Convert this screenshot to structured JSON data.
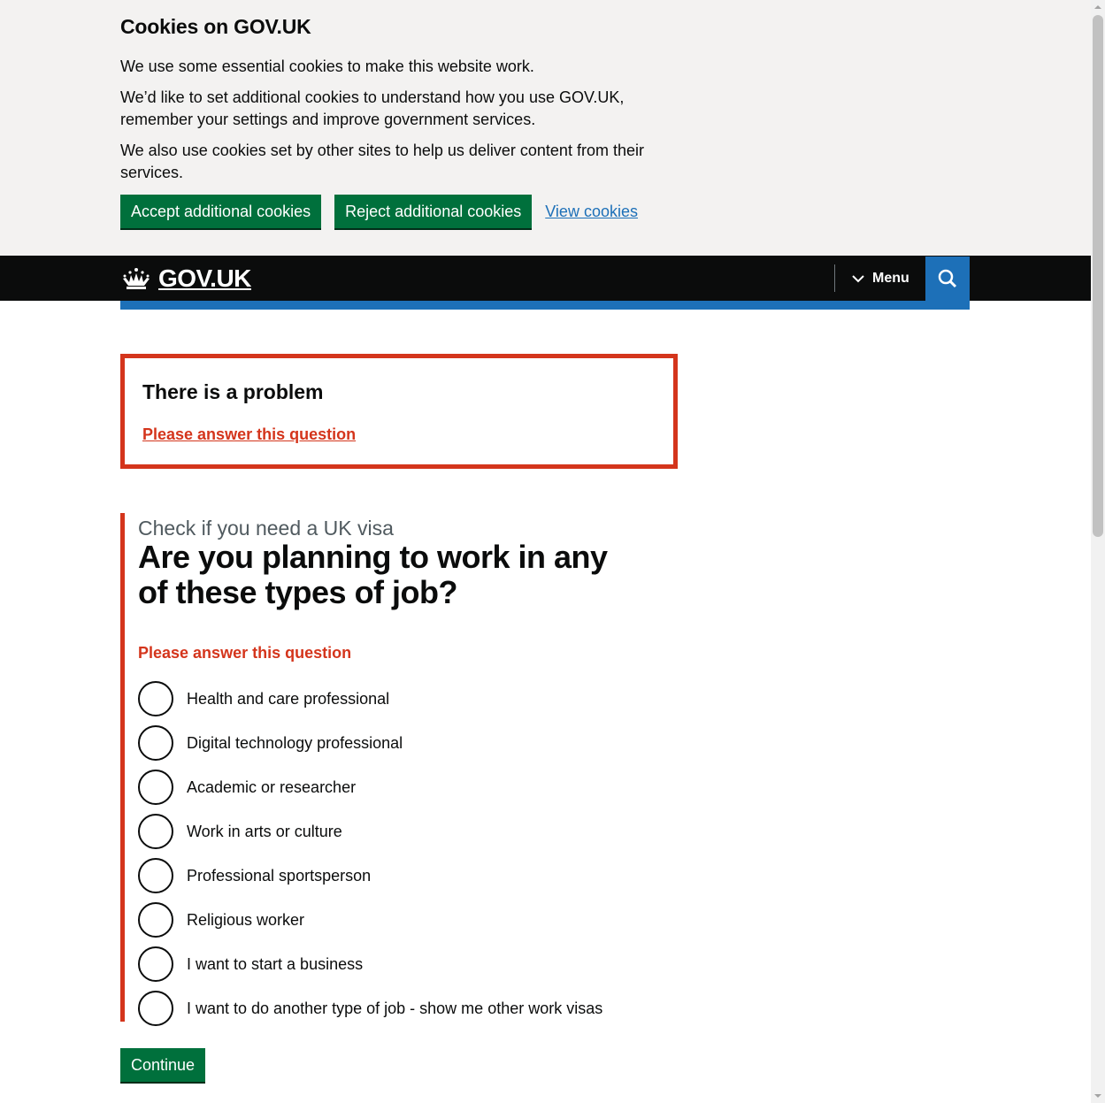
{
  "cookie_banner": {
    "title": "Cookies on GOV.UK",
    "paragraphs": [
      "We use some essential cookies to make this website work.",
      "We’d like to set additional cookies to understand how you use GOV.UK, remember your settings and improve government services.",
      "We also use cookies set by other sites to help us deliver content from their services."
    ],
    "accept_label": "Accept additional cookies",
    "reject_label": "Reject additional cookies",
    "view_label": "View cookies"
  },
  "header": {
    "logo_text": "GOV.UK",
    "menu_label": "Menu",
    "search_icon": "search-icon"
  },
  "error_summary": {
    "title": "There is a problem",
    "link": "Please answer this question"
  },
  "question": {
    "caption": "Check if you need a UK visa",
    "heading": "Are you planning to work in any of these types of job?",
    "error_message": "Please answer this question",
    "options": [
      "Health and care professional",
      "Digital technology professional",
      "Academic or researcher",
      "Work in arts or culture",
      "Professional sportsperson",
      "Religious worker",
      "I want to start a business",
      "I want to do another type of job - show me other work visas"
    ]
  },
  "continue_label": "Continue",
  "colors": {
    "green": "#00703c",
    "error_red": "#d4351c",
    "link_blue": "#1d70b8",
    "header_black": "#0b0c0c"
  }
}
